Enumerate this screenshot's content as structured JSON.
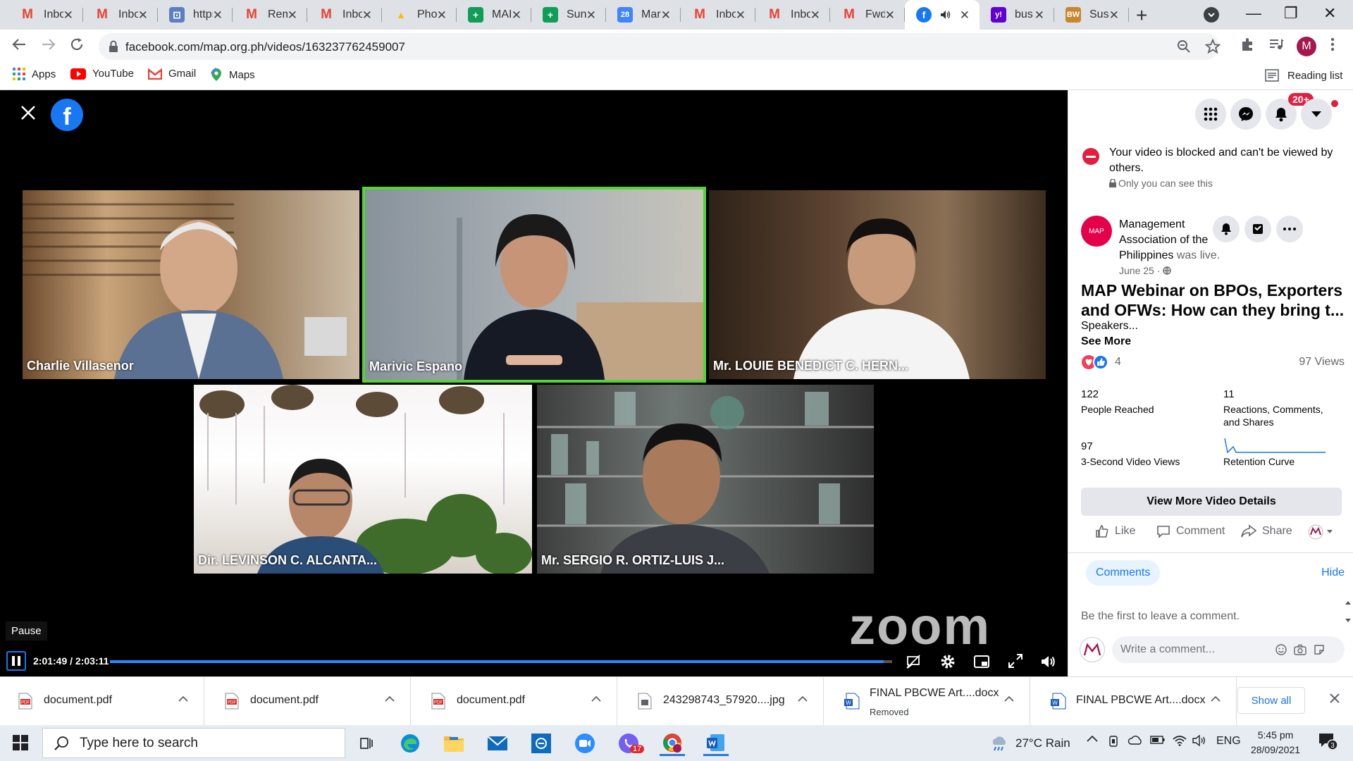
{
  "browser": {
    "tabs": [
      {
        "label": "Inbox",
        "icon": "gmail-icon",
        "color": "#ea4335",
        "glyph": "M",
        "active": false
      },
      {
        "label": "Inbox",
        "icon": "gmail-icon",
        "color": "#ea4335",
        "glyph": "M",
        "active": false
      },
      {
        "label": "https",
        "icon": "web-icon",
        "color": "#5b7fbf",
        "glyph": "⊡",
        "active": false
      },
      {
        "label": "Rem",
        "icon": "gmail-icon",
        "color": "#ea4335",
        "glyph": "M",
        "active": false
      },
      {
        "label": "Inbox",
        "icon": "gmail-icon",
        "color": "#ea4335",
        "glyph": "M",
        "active": false
      },
      {
        "label": "Pho",
        "icon": "drive-icon",
        "color": "#fbbc04",
        "glyph": "▲",
        "active": false
      },
      {
        "label": "MAI",
        "icon": "sheets-icon",
        "color": "#0f9d58",
        "glyph": "+",
        "active": false
      },
      {
        "label": "Sun",
        "icon": "sheets-icon",
        "color": "#0f9d58",
        "glyph": "+",
        "active": false
      },
      {
        "label": "Mar",
        "icon": "calendar-icon",
        "color": "#4285f4",
        "glyph": "28",
        "active": false
      },
      {
        "label": "Inbox",
        "icon": "gmail-icon",
        "color": "#ea4335",
        "glyph": "M",
        "active": false
      },
      {
        "label": "Inbox",
        "icon": "gmail-icon",
        "color": "#ea4335",
        "glyph": "M",
        "active": false
      },
      {
        "label": "Fwd",
        "icon": "gmail-icon",
        "color": "#ea4335",
        "glyph": "M",
        "active": false
      },
      {
        "label": "",
        "icon": "facebook-icon",
        "color": "#1877f2",
        "glyph": "f",
        "active": true
      },
      {
        "label": "bus",
        "icon": "yahoo-icon",
        "color": "#6001d2",
        "glyph": "y!",
        "active": false
      },
      {
        "label": "Sus",
        "icon": "bworld-icon",
        "color": "#c8862d",
        "glyph": "BW",
        "active": false
      }
    ],
    "url": "facebook.com/map.org.ph/videos/163237762459007",
    "profile_initial": "M",
    "bookmarks": [
      {
        "label": "Apps",
        "icon": "apps-grid-icon"
      },
      {
        "label": "YouTube",
        "icon": "youtube-icon"
      },
      {
        "label": "Gmail",
        "icon": "gmail-icon"
      },
      {
        "label": "Maps",
        "icon": "maps-icon"
      }
    ],
    "reading_list": "Reading list"
  },
  "video": {
    "participants": [
      {
        "name": "Charlie Villasenor"
      },
      {
        "name": "Marivic Espano"
      },
      {
        "name": "Mr. LOUIE BENEDICT C. HERN..."
      },
      {
        "name": "Dir. LEVINSON C. ALCANTA..."
      },
      {
        "name": "Mr. SERGIO R. ORTIZ-LUIS J..."
      }
    ],
    "watermark": "zoom",
    "tooltip": "Pause",
    "time": "2:01:49 / 2:03:11",
    "progress": 0.989
  },
  "sidebar": {
    "notifications_badge": "20+",
    "blocked_text": "Your video is blocked and can't be viewed by others.",
    "only_you": "Only you can see this",
    "page_name": "Management Association of the Philippines",
    "was_live": " was live.",
    "date": "June 25 ·",
    "avatar_text": "MAP",
    "title": "MAP Webinar on BPOs, Exporters and OFWs: How can they bring t...",
    "speakers": "Speakers...",
    "see_more": "See More",
    "reaction_count": "4",
    "views": "97 Views",
    "stats": [
      {
        "value": "122",
        "label": "People Reached"
      },
      {
        "value": "11",
        "label": "Reactions, Comments, and Shares"
      },
      {
        "value": "97",
        "label": "3-Second Video Views"
      },
      {
        "value": "",
        "label": "Retention Curve"
      }
    ],
    "more_details": "View More Video Details",
    "actions": {
      "like": "Like",
      "comment": "Comment",
      "share": "Share"
    },
    "comments_tab": "Comments",
    "hide": "Hide",
    "first_comment": "Be the first to leave a comment.",
    "comment_placeholder": "Write a comment..."
  },
  "downloads": {
    "items": [
      {
        "name": "document.pdf",
        "status": "",
        "type": "pdf"
      },
      {
        "name": "document.pdf",
        "status": "",
        "type": "pdf"
      },
      {
        "name": "document.pdf",
        "status": "",
        "type": "pdf"
      },
      {
        "name": "243298743_57920....jpg",
        "status": "",
        "type": "jpg"
      },
      {
        "name": "FINAL PBCWE Art....docx",
        "status": "Removed",
        "type": "docx"
      },
      {
        "name": "FINAL PBCWE Art....docx",
        "status": "",
        "type": "docx"
      }
    ],
    "show_all": "Show all"
  },
  "taskbar": {
    "search_placeholder": "Type here to search",
    "viber_badge": "17",
    "weather": "27°C Rain",
    "lang": "ENG",
    "time": "5:45 pm",
    "date": "28/09/2021",
    "notif_count": "3"
  }
}
